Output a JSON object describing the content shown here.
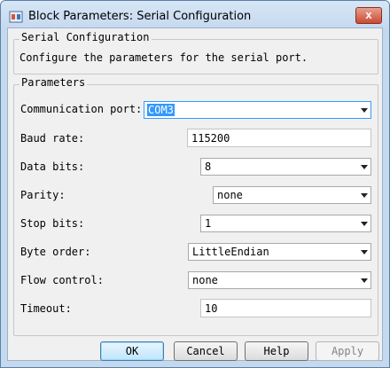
{
  "window": {
    "title": "Block Parameters: Serial Configuration",
    "close_label": "x"
  },
  "group1": {
    "legend": "Serial Configuration",
    "description": "Configure the parameters for the serial port."
  },
  "group2": {
    "legend": "Parameters",
    "fields": [
      {
        "label": "Communication port:",
        "value": "COM3",
        "kind": "dropdown"
      },
      {
        "label": "Baud rate:",
        "value": "115200",
        "kind": "text"
      },
      {
        "label": "Data bits:",
        "value": "8",
        "kind": "dropdown"
      },
      {
        "label": "Parity:",
        "value": "none",
        "kind": "dropdown"
      },
      {
        "label": "Stop bits:",
        "value": "1",
        "kind": "dropdown"
      },
      {
        "label": "Byte order:",
        "value": "LittleEndian",
        "kind": "dropdown"
      },
      {
        "label": "Flow control:",
        "value": "none",
        "kind": "dropdown"
      },
      {
        "label": "Timeout:",
        "value": "10",
        "kind": "text"
      }
    ]
  },
  "buttons": {
    "ok": "OK",
    "cancel": "Cancel",
    "help": "Help",
    "apply": "Apply"
  },
  "colors": {
    "titlebar": "#c5d9ee",
    "close": "#c94a33",
    "focus": "#3399ff",
    "dialog_bg": "#f0f0f0"
  },
  "icons": {
    "app": "simulink-block-icon",
    "close": "close-icon",
    "dropdown": "chevron-down-icon"
  }
}
